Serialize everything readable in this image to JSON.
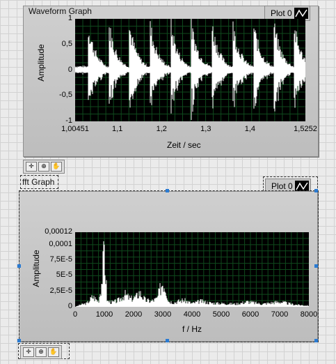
{
  "waveform_graph": {
    "title": "Waveform Graph",
    "legend_label": "Plot 0",
    "xlabel": "Zeit / sec",
    "ylabel": "Amplitude",
    "x_ticks": [
      "1,00451",
      "1,1",
      "1,2",
      "1,3",
      "1,4",
      "1,5252"
    ],
    "y_ticks": [
      "1",
      "0,5",
      "0",
      "-0,5",
      "-1"
    ],
    "palette_icons": [
      "crosshair-icon",
      "zoom-icon",
      "pan-hand-icon"
    ]
  },
  "fft_graph": {
    "title": "fft Graph",
    "legend_label": "Plot 0",
    "xlabel": "f / Hz",
    "ylabel": "Amplitude",
    "x_ticks": [
      "0",
      "1000",
      "2000",
      "3000",
      "4000",
      "5000",
      "6000",
      "7000",
      "8000"
    ],
    "y_ticks": [
      "0,00012",
      "0,0001",
      "7,5E-5",
      "5E-5",
      "2,5E-5",
      "0"
    ],
    "palette_icons": [
      "crosshair-icon",
      "zoom-icon",
      "pan-hand-icon"
    ]
  },
  "chart_data": [
    {
      "type": "line",
      "title": "Waveform Graph",
      "xlabel": "Zeit / sec",
      "ylabel": "Amplitude",
      "xlim": [
        1.00451,
        1.5252
      ],
      "ylim": [
        -1,
        1
      ],
      "grid": true,
      "legend": "top-right",
      "series": [
        {
          "name": "Plot 0",
          "color": "#ffffff",
          "bursts_x": [
            1.035,
            1.082,
            1.128,
            1.175,
            1.222,
            1.268,
            1.315,
            1.362,
            1.409,
            1.455,
            1.5
          ],
          "peak_amplitude": 1.0
        }
      ]
    },
    {
      "type": "line",
      "title": "fft Graph",
      "xlabel": "f / Hz",
      "ylabel": "Amplitude",
      "xlim": [
        0,
        8000
      ],
      "ylim": [
        0,
        0.00012
      ],
      "grid": true,
      "legend": "top-right",
      "series": [
        {
          "name": "Plot 0",
          "color": "#ffffff",
          "x": [
            0,
            200,
            400,
            600,
            800,
            900,
            1000,
            1100,
            1300,
            1500,
            1700,
            1900,
            2100,
            2200,
            2400,
            2600,
            2800,
            2950,
            3000,
            3100,
            3200,
            3400,
            3700,
            4000,
            4300,
            4600,
            5000,
            5500,
            5900,
            6400,
            7000,
            7500,
            8000
          ],
          "y": [
            0,
            4e-06,
            6e-06,
            1.8e-05,
            1e-05,
            4e-05,
            0.0001,
            1e-05,
            8e-06,
            1.2e-05,
            2.2e-05,
            1.4e-05,
            1.8e-05,
            2.6e-05,
            1.2e-05,
            1e-05,
            1.4e-05,
            3.8e-05,
            4.5e-05,
            3.5e-05,
            1e-05,
            8e-06,
            1.2e-05,
            6e-06,
            1e-05,
            7e-06,
            6e-06,
            5e-06,
            9e-06,
            5e-06,
            9e-06,
            4e-06,
            2e-06
          ]
        }
      ]
    }
  ]
}
